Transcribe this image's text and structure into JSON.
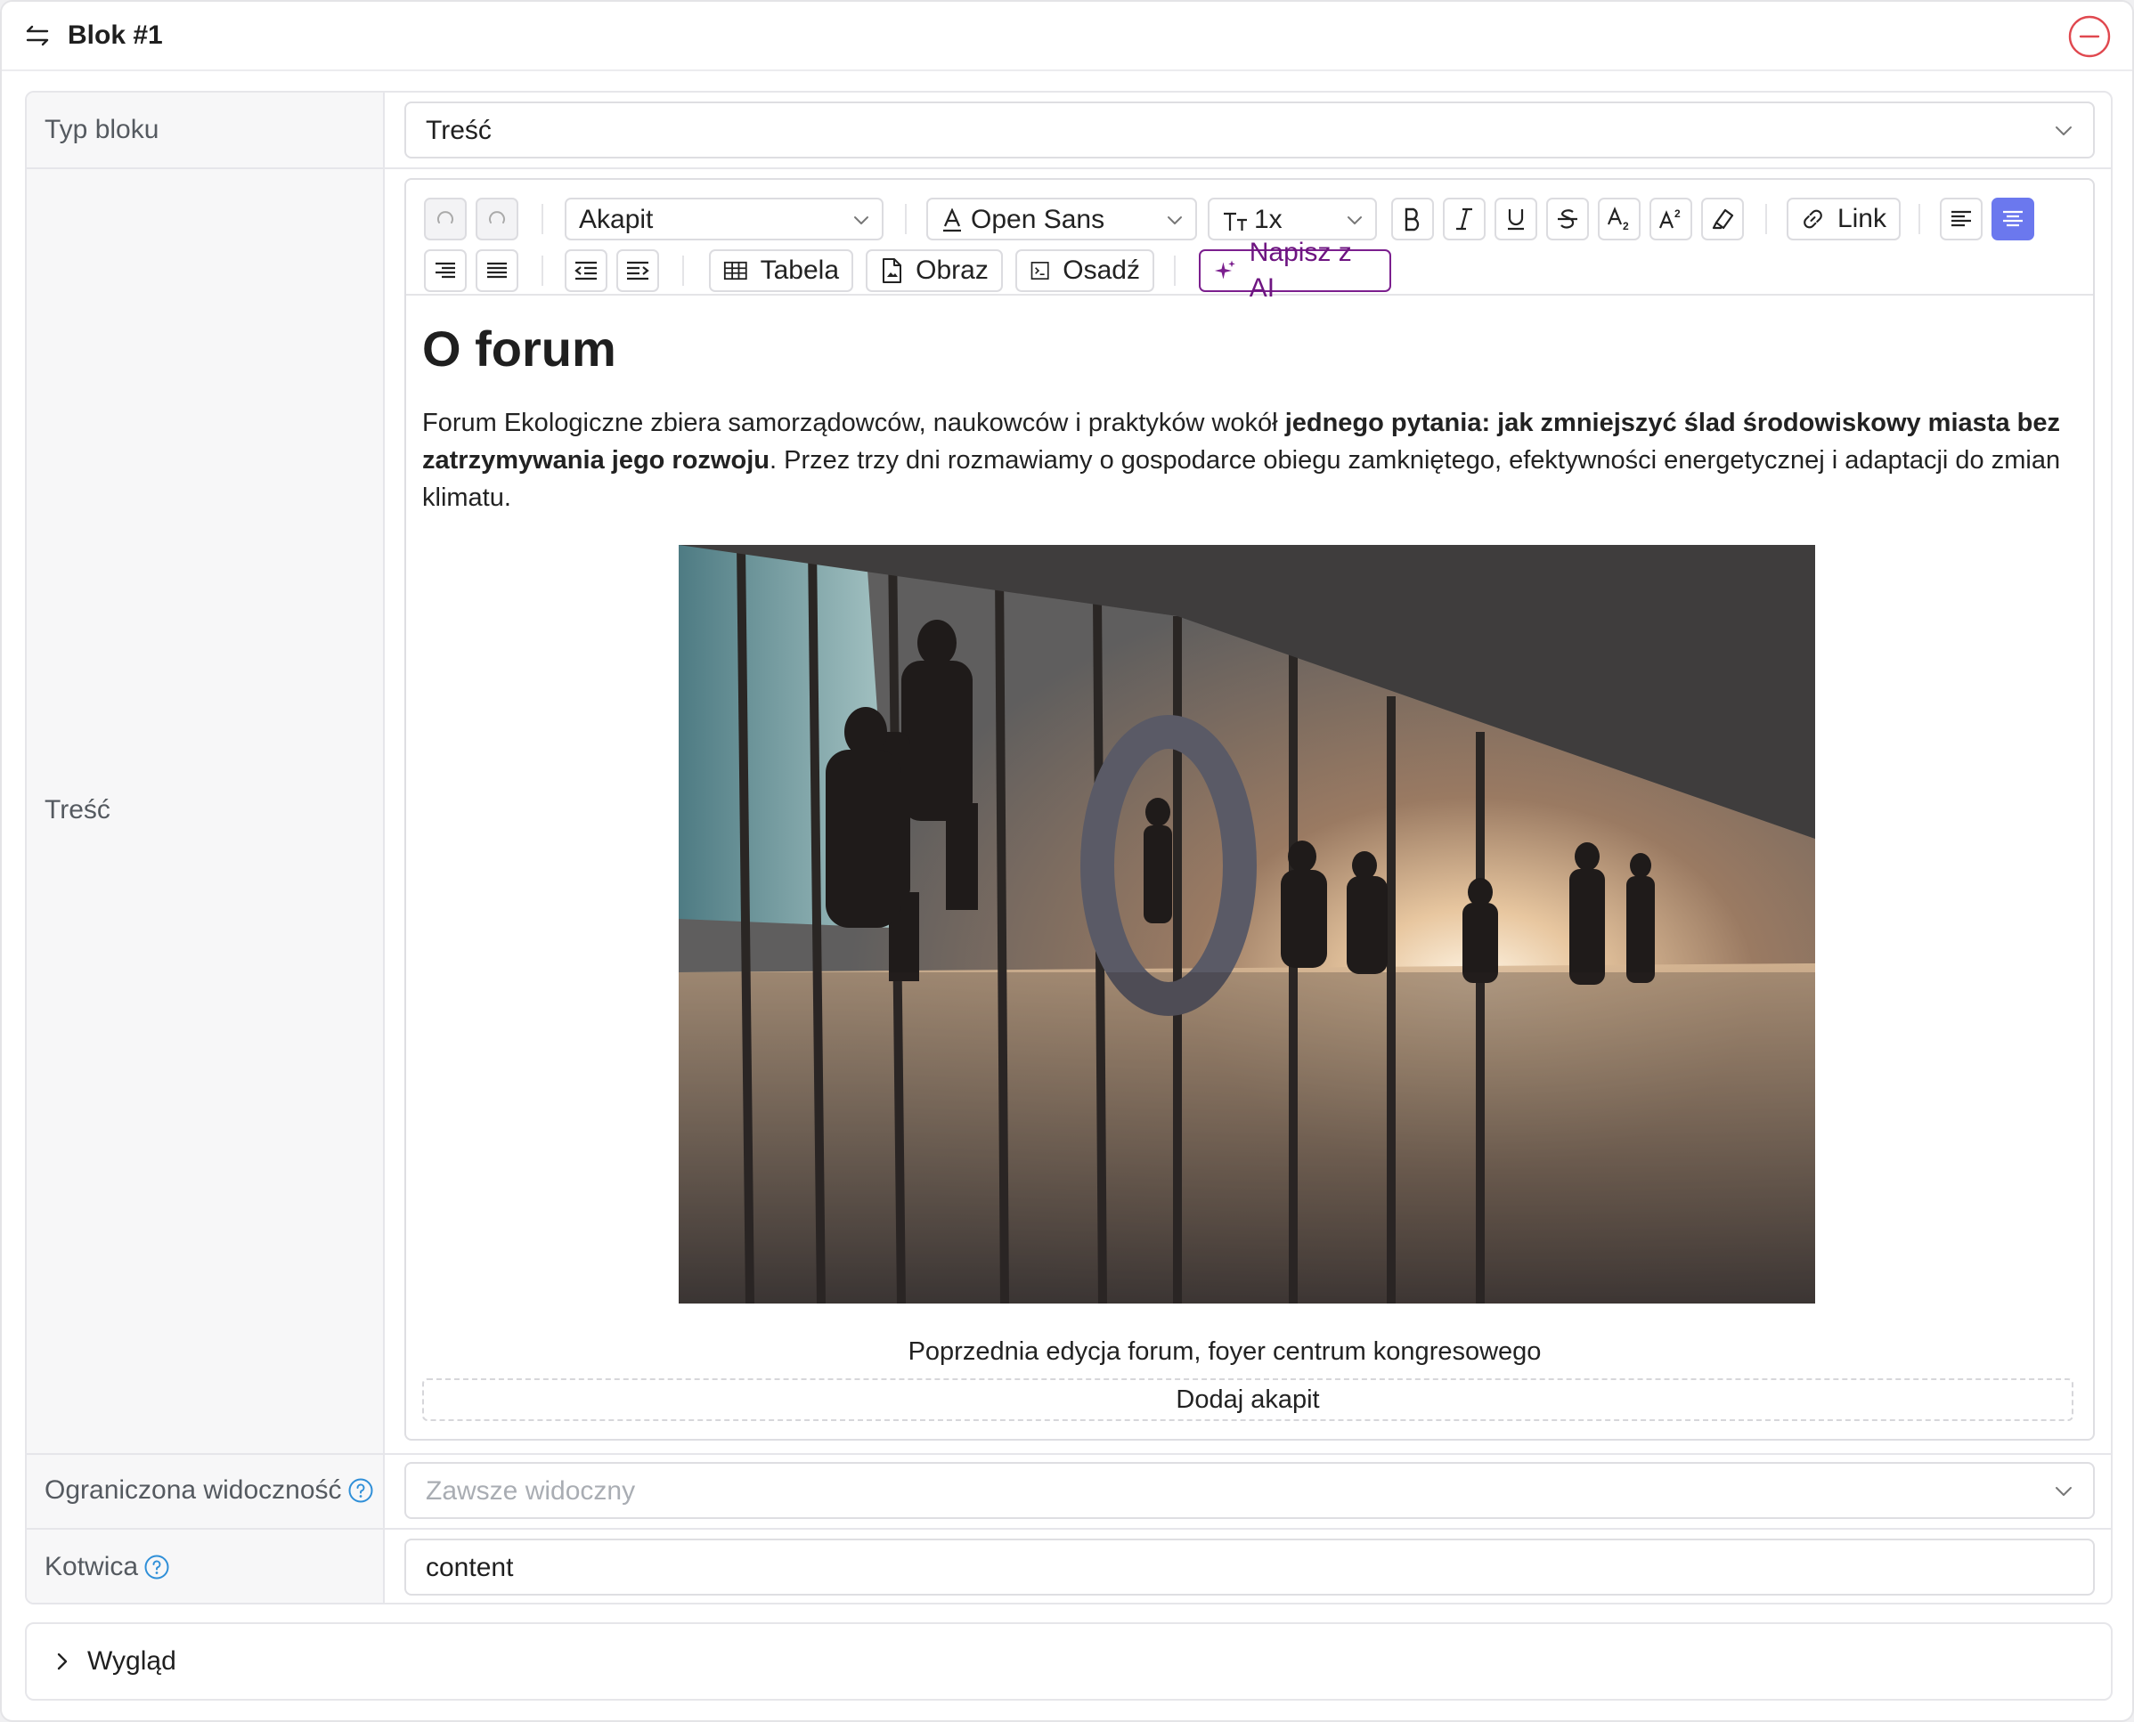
{
  "header": {
    "title": "Blok #1"
  },
  "block_type": {
    "label": "Typ bloku",
    "value": "Treść"
  },
  "content_field": {
    "label": "Treść"
  },
  "toolbar": {
    "paragraph_style": "Akapit",
    "font_family": "Open Sans",
    "font_size": "1x",
    "link_label": "Link",
    "table_label": "Tabela",
    "image_label": "Obraz",
    "embed_label": "Osadź",
    "ai_label": "Napisz z AI",
    "accent_color": "#6b78ee",
    "ai_color": "#7b1f8e"
  },
  "editor": {
    "heading": "O forum",
    "paragraph_start": "Forum Ekologiczne zbiera samorządowców, naukowców i praktyków wokół ",
    "paragraph_bold": "jednego pytania: jak zmniejszyć ślad środowiskowy miasta bez zatrzymywania jego rozwoju",
    "paragraph_end": ". Przez trzy dni rozmawiamy o gospodarce obiegu zamkniętego, efektywności energetycznej i adaptacji do zmian klimatu.",
    "image_caption": "Poprzednia edycja forum, foyer centrum kongresowego",
    "add_paragraph": "Dodaj akapit"
  },
  "visibility": {
    "label": "Ograniczona widoczność",
    "placeholder": "Zawsze widoczny"
  },
  "anchor": {
    "label": "Kotwica",
    "value": "content"
  },
  "appearance": {
    "label": "Wygląd"
  }
}
